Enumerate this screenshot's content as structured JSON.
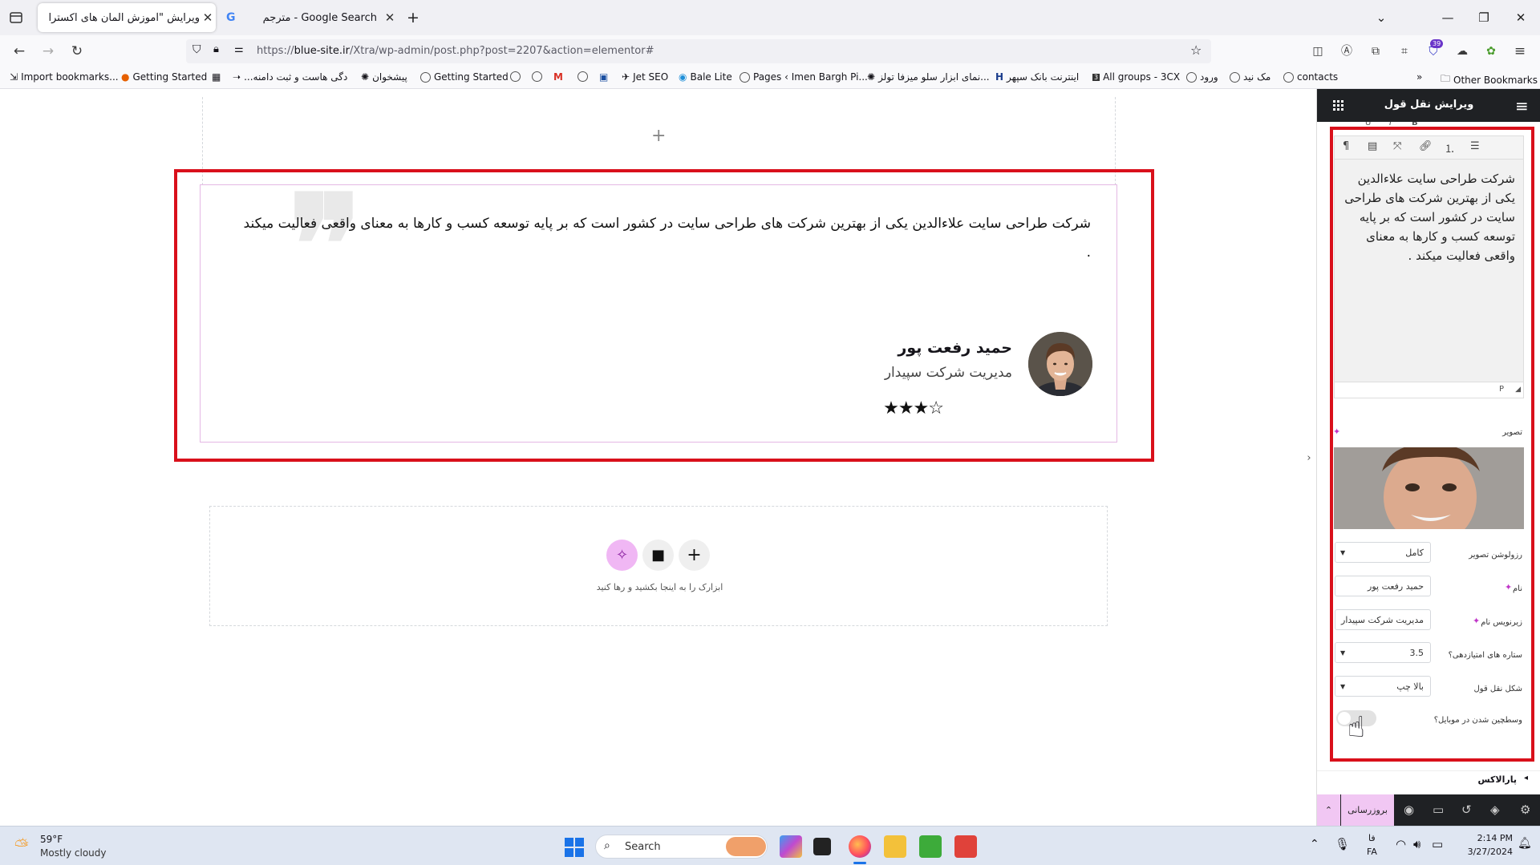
{
  "browser": {
    "tabs": [
      {
        "title": "ویرایش \"آموزش المان های اکسترا – ع",
        "active": true
      },
      {
        "title": "Google Search - مترجم",
        "active": false
      }
    ],
    "url_prefix": "https://",
    "url_domain": "blue-site.ir",
    "url_path": "/Xtra/wp-admin/post.php?post=2207&action=elementor#",
    "extensions_badge": "39",
    "bookmarks": [
      "Import bookmarks...",
      "Getting Started",
      "دگی هاست و ثبت دامنه...",
      "پیشخوان",
      "Getting Started",
      "Jet SEO",
      "Bale Lite",
      "Pages ‹ Imen Bargh Pi...",
      "...نمای ابزار سلو میزفا تولز",
      "اینترنت بانک سپهر",
      "All groups - 3CX",
      "ورود",
      "مک نید",
      "contacts"
    ],
    "other_bookmarks": "Other Bookmarks"
  },
  "testimonial": {
    "text": "شرکت طراحی سایت علاءالدین یکی از بهترین شرکت های طراحی سایت در کشور است که بر پایه توسعه کسب و کارها به معنای واقعی فعالیت میکند .",
    "name": "حمید رفعت پور",
    "title": "مدیریت شرکت سپیدار",
    "rating": 3.5,
    "stars_display": "★★★☆"
  },
  "empty_section": {
    "hint": "ابزارک را به اینجا بکشید و رها کنید",
    "add_icon": "plus-icon",
    "folder_icon": "folder-icon",
    "ai_icon": "sparkle-icon"
  },
  "panel": {
    "title": "ویرایش نقل قول",
    "editor_text": "شرکت طراحی سایت علاءالدین یکی از بهترین شرکت های طراحی سایت در کشور است که بر پایه توسعه کسب و کارها به معنای واقعی فعالیت میکند .",
    "editor_path": "P",
    "image_label": "تصویر",
    "resolution_label": "رزولوشن تصویر",
    "resolution_value": "کامل",
    "name_label": "نام",
    "name_value": "حمید رفعت پور",
    "subtitle_label": "زیرنویس نام",
    "subtitle_value": "مدیریت شرکت سپیدار",
    "rating_label": "ستاره های امتیازدهی؟",
    "rating_value": "3.5",
    "shape_label": "شکل نقل قول",
    "shape_value": "بالا چپ",
    "mobile_center_label": "وسطچین شدن در موبایل؟",
    "parallax_label": "پارالاکس",
    "update_button": "بروزرسانی"
  },
  "taskbar": {
    "temp": "59°F",
    "weather": "Mostly cloudy",
    "search": "Search",
    "lang_top": "فا",
    "lang_bottom": "FA",
    "time": "2:14 PM",
    "date": "3/27/2024"
  }
}
